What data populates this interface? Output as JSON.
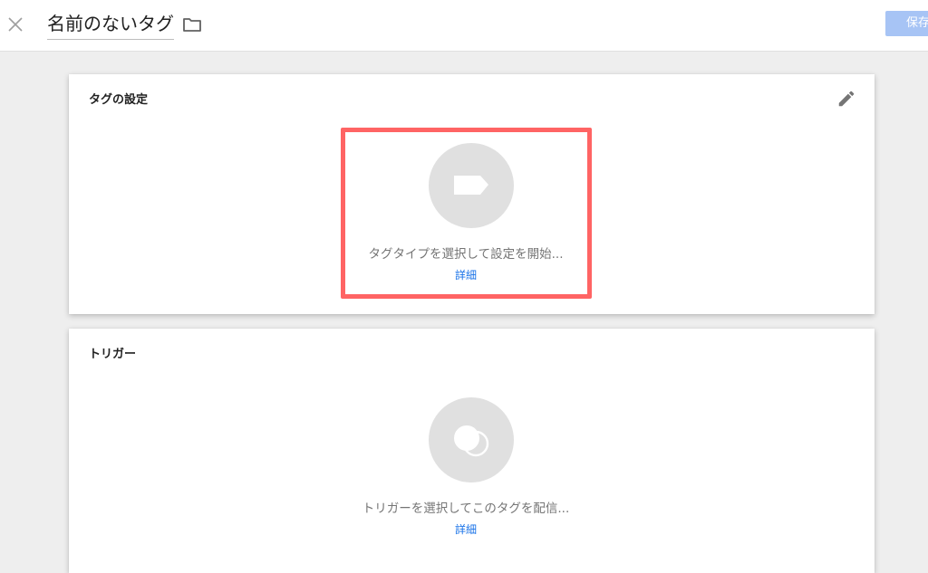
{
  "header": {
    "title": "名前のないタグ",
    "save_label": "保存",
    "close_icon": "close-icon",
    "folder_icon": "folder-icon"
  },
  "tag_config": {
    "title": "タグの設定",
    "edit_icon": "pencil-icon",
    "prompt": "タグタイプを選択して設定を開始...",
    "details_link": "詳細",
    "icon": "tag-icon"
  },
  "trigger": {
    "title": "トリガー",
    "prompt": "トリガーを選択してこのタグを配信...",
    "details_link": "詳細",
    "icon": "trigger-circles-icon"
  },
  "colors": {
    "highlight": "#ff6464",
    "link": "#1a73e8",
    "save_button": "#a7c4f5",
    "icon_circle": "#e0e0e0"
  }
}
